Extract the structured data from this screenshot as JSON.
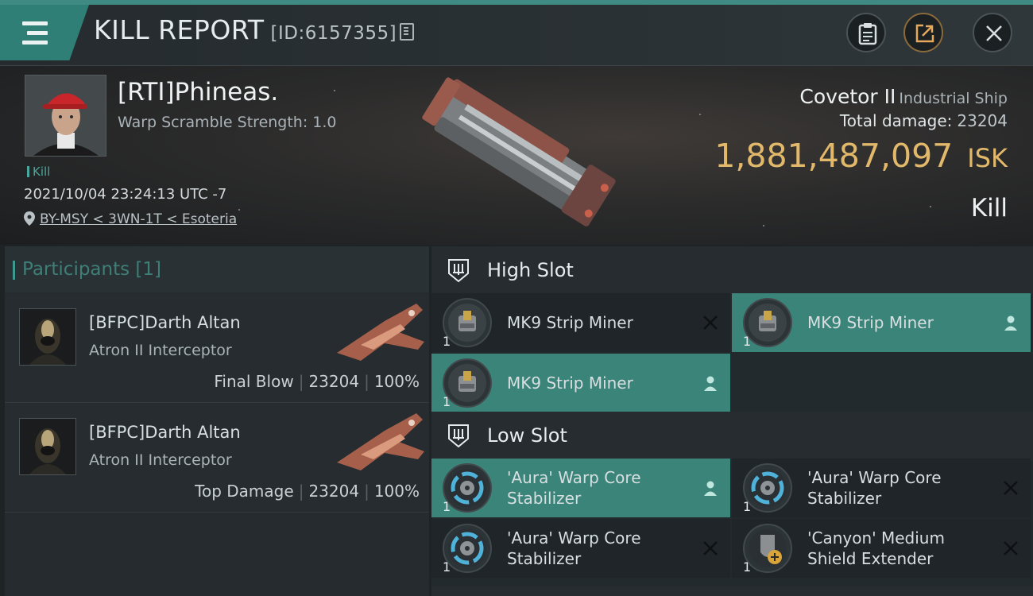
{
  "header": {
    "title": "KILL REPORT",
    "id_label": "[ID:6157355]",
    "icons": [
      "menu-icon",
      "clipboard-icon",
      "share-icon",
      "close-icon"
    ]
  },
  "victim": {
    "name": "[RTI]Phineas.",
    "warp_line": "Warp Scramble Strength: 1.0",
    "tag": "Kill",
    "datetime": "2021/10/04 23:24:13 UTC -7",
    "location": "BY-MSY < 3WN-1T < Esoteria",
    "ship_name": "Covetor II",
    "ship_class": "Industrial Ship",
    "total_damage_label": "Total damage:",
    "total_damage_value": "23204",
    "isk_value": "1,881,487,097",
    "isk_unit": "ISK",
    "result": "Kill"
  },
  "participants": {
    "header": "Participants [1]",
    "items": [
      {
        "name": "[BFPC]Darth Altan",
        "ship": "Atron II Interceptor",
        "role": "Final Blow",
        "damage": "23204",
        "percent": "100%"
      },
      {
        "name": "[BFPC]Darth Altan",
        "ship": "Atron II Interceptor",
        "role": "Top Damage",
        "damage": "23204",
        "percent": "100%"
      }
    ]
  },
  "slots": {
    "high": {
      "label": "High Slot",
      "modules": [
        {
          "name": "MK9 Strip Miner",
          "qty": "1",
          "status": "destroyed",
          "highlight": false
        },
        {
          "name": "MK9 Strip Miner",
          "qty": "1",
          "status": "dropped",
          "highlight": true
        },
        {
          "name": "MK9 Strip Miner",
          "qty": "1",
          "status": "dropped",
          "highlight": true
        }
      ]
    },
    "low": {
      "label": "Low Slot",
      "modules": [
        {
          "name": "'Aura' Warp Core Stabilizer",
          "qty": "1",
          "status": "dropped",
          "highlight": true
        },
        {
          "name": "'Aura' Warp Core Stabilizer",
          "qty": "1",
          "status": "destroyed",
          "highlight": false
        },
        {
          "name": "'Aura' Warp Core Stabilizer",
          "qty": "1",
          "status": "destroyed",
          "highlight": false
        },
        {
          "name": "'Canyon' Medium Shield Extender",
          "qty": "1",
          "status": "destroyed",
          "highlight": false
        }
      ]
    }
  },
  "colors": {
    "accent_teal": "#3b8479",
    "isk_gold": "#e2b96a",
    "background": "#1e2326"
  }
}
